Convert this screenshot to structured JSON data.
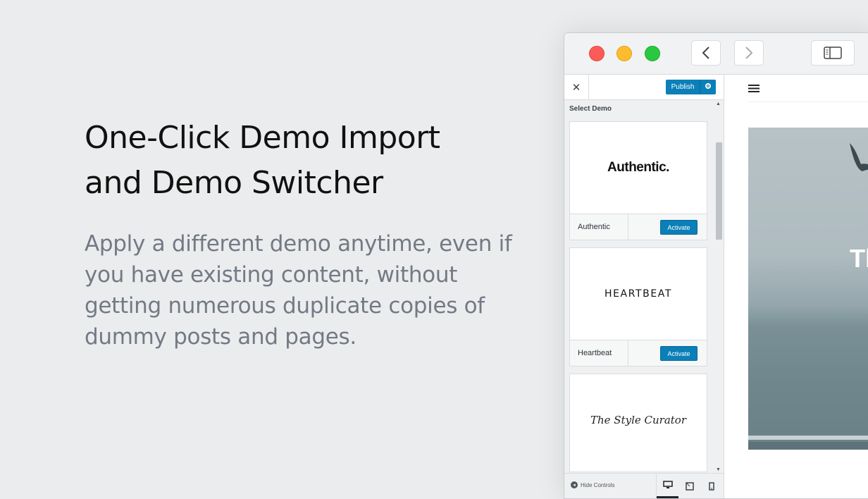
{
  "hero": {
    "title_line1": "One-Click Demo Import",
    "title_line2": "and Demo Switcher",
    "description": "Apply a different demo anytime, even if you have existing content, without getting numerous duplicate copies of dummy posts and pages."
  },
  "browser": {
    "controls": [
      "close-dot",
      "minimize-dot",
      "zoom-dot"
    ],
    "nav": {
      "back_icon": "chevron-left-icon",
      "forward_icon": "chevron-right-icon",
      "sidebar_icon": "sidebar-icon"
    }
  },
  "customizer": {
    "close_label": "✕",
    "publish_label": "Publish",
    "section_title": "Select Demo",
    "demos": [
      {
        "logo": "Authentic.",
        "name": "Authentic",
        "button": "Activate"
      },
      {
        "logo": "HEARTBEAT",
        "name": "Heartbeat",
        "button": "Activate"
      },
      {
        "logo": "The Style Curator"
      }
    ],
    "footer": {
      "hide_controls_label": "Hide Controls"
    }
  },
  "site": {
    "hero_heading": "Tl"
  },
  "colors": {
    "accent": "#0a7fb8",
    "background": "#ebeced",
    "text_muted": "#737a85"
  }
}
